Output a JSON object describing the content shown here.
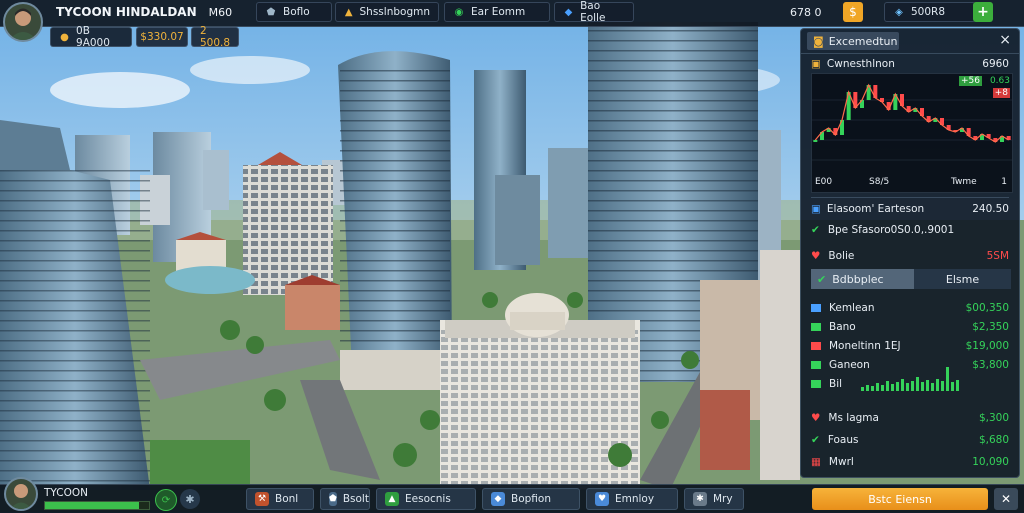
{
  "colors": {
    "accent_gold": "#f0b33c",
    "accent_green": "#35d35a",
    "accent_red": "#ff4b4b",
    "panel_bg": "#101a26",
    "cta_orange": "#f5a623"
  },
  "top_bar": {
    "game_title": "TYCOON HINDALDAN",
    "title_suffix": "M60",
    "stat_a": "0B 9A000",
    "money_a": "$330.07",
    "money_b": "2 500.8",
    "tabs": [
      {
        "label": "Boflo",
        "icon": "shield-icon"
      },
      {
        "label": "Shsslnbogmn",
        "icon": "chart-icon"
      },
      {
        "label": "Ear Eomm",
        "icon": "leaf-icon"
      },
      {
        "label": "Bao Eolle",
        "icon": "gem-icon"
      }
    ],
    "balance": "678 0",
    "gold_button_icon": "coin-icon",
    "premium_value": "500R8",
    "plus_label": "+"
  },
  "panel": {
    "title": "Excemedtun",
    "close": "×",
    "chart_title": "Cwnesthlnon",
    "chart_value": "6960",
    "badge_green": "+56",
    "badge_green2": "0.63",
    "badge_red": "+8",
    "x_labels": [
      "E00",
      "S8/5",
      "Twme",
      "1"
    ],
    "section_title": "Elasoom' Earteson",
    "section_value": "240.50",
    "info_line": "Bpe Sfasoro0S0.0,.9001",
    "health_label": "Bolie",
    "health_value": "5SM",
    "tab_active": "Bdbbplec",
    "tab_other": "Elsme",
    "stats": [
      {
        "label": "Kemlean",
        "value": "$00,350",
        "color": "#4aa0ff"
      },
      {
        "label": "Bano",
        "value": "$2,350",
        "color": "#35d35a"
      },
      {
        "label": "Moneltinn 1EJ",
        "value": "$19,000",
        "color": "#ff4b4b"
      },
      {
        "label": "Ganeon",
        "value": "$3,800",
        "color": "#35d35a"
      },
      {
        "label": "Bil",
        "value": "",
        "color": "#35d35a"
      }
    ],
    "lower": [
      {
        "label": "Ms lagma",
        "value": "$,300",
        "color": "#ff4b4b"
      },
      {
        "label": "Foaus",
        "value": "$,680",
        "color": "#35d35a"
      },
      {
        "label": "Mwrl",
        "value": "10,090",
        "color": "#ff4b4b"
      }
    ]
  },
  "bottom_bar": {
    "player_name": "TYCOON",
    "level_progress": 0.9,
    "buttons": [
      {
        "label": "Bonl",
        "icon": "hammer-icon"
      },
      {
        "label": "Bsolt",
        "icon": "shield-icon"
      },
      {
        "label": "Eesocnis",
        "icon": "chart-icon"
      },
      {
        "label": "Bopfion",
        "icon": "gem-icon"
      },
      {
        "label": "Emnloy",
        "icon": "heart-icon"
      },
      {
        "label": "Mry",
        "icon": "gear-icon"
      }
    ],
    "cta_label": "Bstc Eiensn",
    "close_icon": "close-icon"
  },
  "chart_data": {
    "type": "line",
    "title": "Cwnesthlnon",
    "x_ticks": [
      "E00",
      "S8/5",
      "Twme",
      "1"
    ],
    "series": [
      {
        "values": [
          40,
          48,
          52,
          45,
          60,
          88,
          72,
          80,
          95,
          82,
          78,
          70,
          86,
          74,
          68,
          72,
          64,
          58,
          62,
          55,
          50,
          48,
          52,
          44,
          40,
          46,
          42,
          38,
          44,
          40
        ]
      }
    ],
    "ylim": [
      0,
      100
    ]
  }
}
